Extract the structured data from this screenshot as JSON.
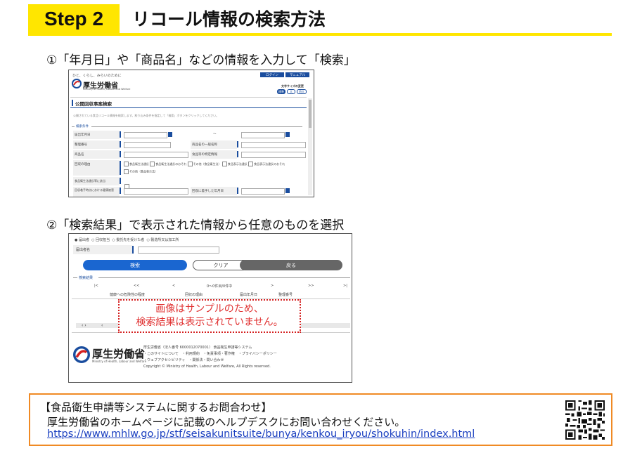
{
  "header": {
    "step_label": "Step 2",
    "title": "リコール情報の検索方法",
    "accent_color": "#ffe600"
  },
  "step1": {
    "text": "①「年月日」や「商品名」などの情報を入力して「検索」",
    "screenshot": {
      "tagline": "ひと、くらし、みらいのために",
      "logo_text": "厚生労働省",
      "logo_sub": "Ministry of Health, Labour and Welfare",
      "page_title": "公開回収事案検索",
      "intro": "公開されている食品リコール情報を検索します。絞り込み条件を指定して「検索」ボタンをクリックしてください。",
      "section": "検索条件",
      "top_buttons": [
        "ログイン",
        "マニュアル"
      ],
      "fontsize_label": "文字サイズの変更",
      "fontsize_opts": [
        "標準",
        "大",
        "特大"
      ],
      "rows": [
        {
          "label": "届出年月日",
          "right_label": "",
          "tilde": "～"
        },
        {
          "label": "整理番号",
          "right_label": "商品名の一般名称"
        },
        {
          "label": "商品名",
          "right_label": "食品等の特定情報"
        },
        {
          "label": "回収の理由",
          "right_label": ""
        },
        {
          "label": "食品衛生法違反等に該当",
          "right_label": ""
        },
        {
          "label": "回収着手時点における健康被害",
          "right_label": "回収に着手した年月日"
        }
      ],
      "reasons": [
        "食品衛生法違反",
        "食品衛生法違反のおそれ",
        "その他（食品衛生法）",
        "食品表示法違反",
        "食品表示法違反のおそれ",
        "その他（食品表示法）"
      ]
    }
  },
  "step2": {
    "text": "②「検索結果」で表示された情報から任意のものを選択",
    "screenshot": {
      "radios": [
        "届出者",
        "回収担当",
        "委託先を受けた者",
        "製造所又は加工所"
      ],
      "name_label": "届出者名",
      "search_btn": "検索",
      "clear_btn": "クリア",
      "back_btn": "戻る",
      "results_label": "検索結果",
      "pager": [
        "|<",
        "<<",
        "<",
        "0～0件目/0件中",
        ">",
        ">>",
        ">|"
      ],
      "cols": [
        "健康への危険性の程度",
        "回収の理由",
        "届出年月日",
        "整理番号"
      ],
      "sample_line1": "画像はサンプルのため、",
      "sample_line2": "検索結果は表示されていません。",
      "footer_logo": "厚生労働省",
      "footer_logo_sub": "Ministry of Health, Labour and Welfare",
      "footer_lines": [
        "厚生労働省（法人番号 6000012070001）  食品衛生申請等システム",
        "・このサイトについて　・利用規約　・免責事項・著作権　・プライバシーポリシー",
        "・ウェブアクセシビリティ　・関係法・問い合わせ",
        "Copyright © Ministry of Health, Labour and Welfare, All Rights reserved."
      ]
    }
  },
  "contact": {
    "heading": "【食品衛生申請等システムに関するお問合わせ】",
    "body": "厚生労働省のホームページに記載のヘルプデスクにお問い合わせください。",
    "url": "https://www.mhlw.go.jp/stf/seisakunitsuite/bunya/kenkou_iryou/shokuhin/index.html",
    "border_color": "#f08a24"
  }
}
